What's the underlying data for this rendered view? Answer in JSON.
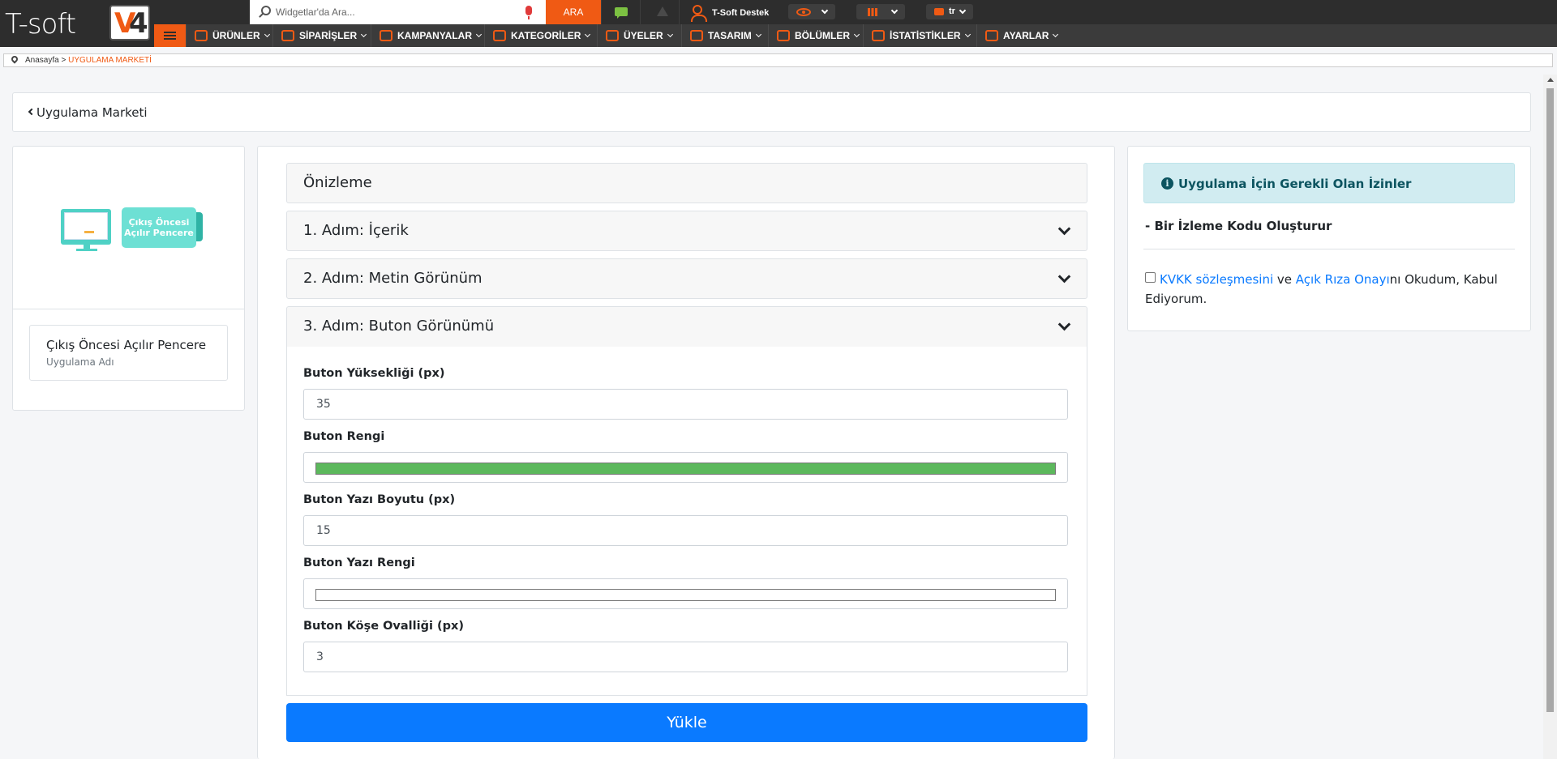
{
  "brand": {
    "logo_text": "T-soft",
    "logo_badge_v": "V",
    "logo_badge_4": "4",
    "accent": "#f05a14"
  },
  "topbar": {
    "search_placeholder": "Widgetlar'da Ara...",
    "search_button": "ARA",
    "user_name": "T-Soft Destek",
    "language": "tr"
  },
  "nav": {
    "items": [
      {
        "label": "ÜRÜNLER",
        "icon": "shirt-icon"
      },
      {
        "label": "SİPARİŞLER",
        "icon": "cart-icon"
      },
      {
        "label": "KAMPANYALAR",
        "icon": "tag-icon"
      },
      {
        "label": "KATEGORİLER",
        "icon": "sitemap-icon"
      },
      {
        "label": "ÜYELER",
        "icon": "users-icon"
      },
      {
        "label": "TASARIM",
        "icon": "brush-icon"
      },
      {
        "label": "BÖLÜMLER",
        "icon": "sections-icon"
      },
      {
        "label": "İSTATİSTİKLER",
        "icon": "chart-icon"
      },
      {
        "label": "AYARLAR",
        "icon": "settings-list-icon"
      }
    ]
  },
  "breadcrumb": {
    "home": "Anasayfa",
    "separator": " > ",
    "current": "UYGULAMA MARKETİ"
  },
  "header": {
    "back_label": "Uygulama Marketi"
  },
  "app": {
    "badge_line1": "Çıkış Öncesi",
    "badge_line2": "Açılır Pencere",
    "name": "Çıkış Öncesi Açılır Pencere",
    "name_caption": "Uygulama Adı"
  },
  "accordion": {
    "preview": "Önizleme",
    "step1": "1. Adım: İçerik",
    "step2": "2. Adım: Metin Görünüm",
    "step3": "3. Adım: Buton Görünümü"
  },
  "form": {
    "height_label": "Buton Yüksekliği (px)",
    "height_value": "35",
    "color_label": "Buton Rengi",
    "color_value": "#5cb85c",
    "font_size_label": "Buton Yazı Boyutu (px)",
    "font_size_value": "15",
    "text_color_label": "Buton Yazı Rengi",
    "text_color_value": "#ffffff",
    "radius_label": "Buton Köşe Ovalliği (px)",
    "radius_value": "3"
  },
  "upload_button": "Yükle",
  "permissions": {
    "title": "Uygulama İçin Gerekli Olan İzinler",
    "items": [
      "- Bir İzleme Kodu Oluşturur"
    ],
    "kvkk_link": "KVKK sözleşmesini",
    "kvkk_and": " ve ",
    "consent_link": "Açık Rıza Onayı",
    "kvkk_rest": "nı Okudum, Kabul Ediyorum."
  }
}
